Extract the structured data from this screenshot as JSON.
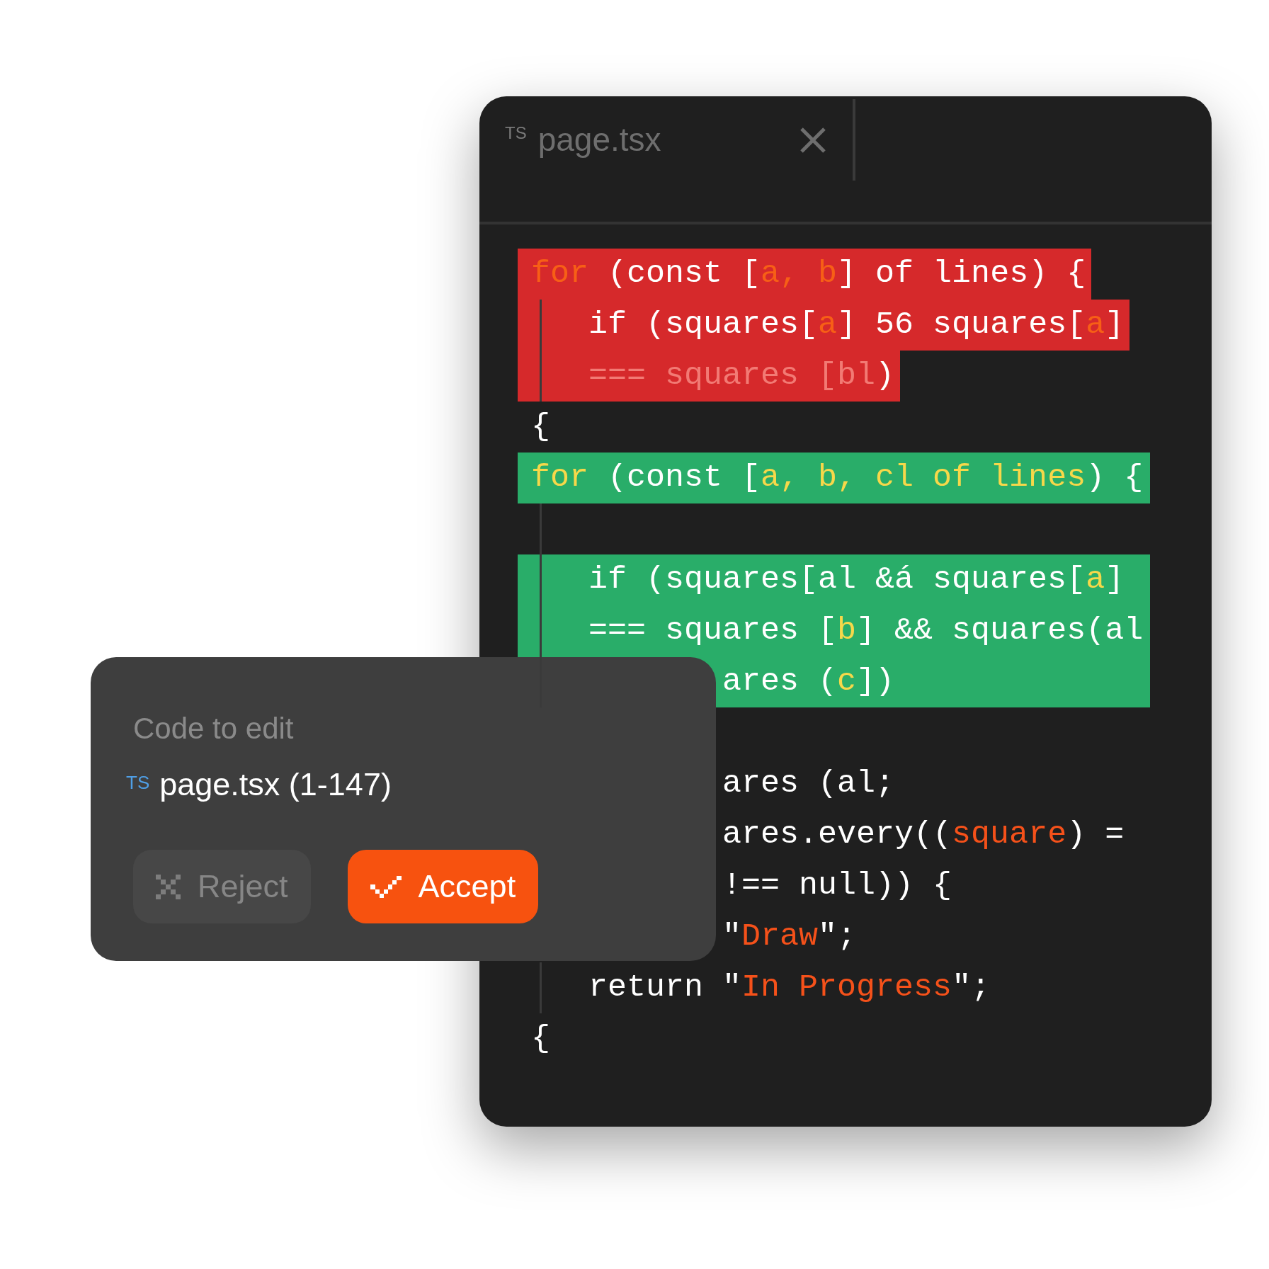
{
  "editor": {
    "tab": {
      "badge": "TS",
      "filename": "page.tsx"
    },
    "lines": [
      {
        "kind": "removed",
        "guide": false,
        "segments": [
          {
            "text": "for",
            "kind": "keyword"
          },
          {
            "text": " (const [",
            "kind": "plain"
          },
          {
            "text": "a, b",
            "kind": "keyword"
          },
          {
            "text": "] of lines) {",
            "kind": "plain"
          }
        ]
      },
      {
        "kind": "removed",
        "guide": true,
        "segments": [
          {
            "text": "   if (squares[",
            "kind": "plain"
          },
          {
            "text": "a",
            "kind": "keyword"
          },
          {
            "text": "] 56 squares[",
            "kind": "plain"
          },
          {
            "text": "a",
            "kind": "keyword"
          },
          {
            "text": "]",
            "kind": "plain"
          }
        ]
      },
      {
        "kind": "removed",
        "guide": true,
        "segments": [
          {
            "text": "   === squares [bl",
            "kind": "faded"
          },
          {
            "text": ")",
            "kind": "plain"
          }
        ]
      },
      {
        "kind": "none",
        "guide": false,
        "segments": [
          {
            "text": "{",
            "kind": "plain"
          }
        ]
      },
      {
        "kind": "added",
        "guide": false,
        "segments": [
          {
            "text": "for",
            "kind": "keyword"
          },
          {
            "text": " (const [",
            "kind": "plain"
          },
          {
            "text": "a, b, cl of lines",
            "kind": "keyword"
          },
          {
            "text": ") {",
            "kind": "plain"
          }
        ]
      },
      {
        "kind": "none",
        "guide": true
      },
      {
        "kind": "added",
        "guide": true,
        "segments": [
          {
            "text": "   if (squares[al &á squares[",
            "kind": "plain"
          },
          {
            "text": "a",
            "kind": "keyword"
          },
          {
            "text": "]",
            "kind": "plain"
          }
        ]
      },
      {
        "kind": "added",
        "guide": true,
        "segments": [
          {
            "text": "   === squares [",
            "kind": "plain"
          },
          {
            "text": "b",
            "kind": "keyword"
          },
          {
            "text": "] && squares(al",
            "kind": "plain"
          }
        ]
      },
      {
        "kind": "added",
        "guide": true,
        "segments": [
          {
            "text": "          ares (",
            "kind": "plain"
          },
          {
            "text": "c",
            "kind": "keyword"
          },
          {
            "text": "])",
            "kind": "plain"
          }
        ]
      },
      {
        "kind": "none",
        "guide": false
      },
      {
        "kind": "none",
        "guide": false,
        "segments": [
          {
            "text": "          ares (al;",
            "kind": "plain"
          }
        ]
      },
      {
        "kind": "none",
        "guide": false,
        "segments": [
          {
            "text": "          ares.every((",
            "kind": "plain"
          },
          {
            "text": "square",
            "kind": "string"
          },
          {
            "text": ") =",
            "kind": "plain"
          }
        ]
      },
      {
        "kind": "none",
        "guide": false,
        "segments": [
          {
            "text": "          !== null)) {",
            "kind": "plain"
          }
        ]
      },
      {
        "kind": "none",
        "guide": false,
        "segments": [
          {
            "text": "          \"",
            "kind": "plain"
          },
          {
            "text": "Draw",
            "kind": "string"
          },
          {
            "text": "\";",
            "kind": "plain"
          }
        ]
      },
      {
        "kind": "none",
        "guide": true,
        "segments": [
          {
            "text": "   return \"",
            "kind": "plain"
          },
          {
            "text": "In Progress",
            "kind": "string"
          },
          {
            "text": "\";",
            "kind": "plain"
          }
        ]
      },
      {
        "kind": "none",
        "guide": false,
        "segments": [
          {
            "text": "{",
            "kind": "plain"
          }
        ]
      }
    ]
  },
  "popup": {
    "title": "Code to edit",
    "file_badge": "TS",
    "file": "page.tsx (1-147)",
    "buttons": [
      {
        "label": "Reject",
        "kind": "secondary"
      },
      {
        "label": "Accept",
        "kind": "primary"
      }
    ]
  }
}
